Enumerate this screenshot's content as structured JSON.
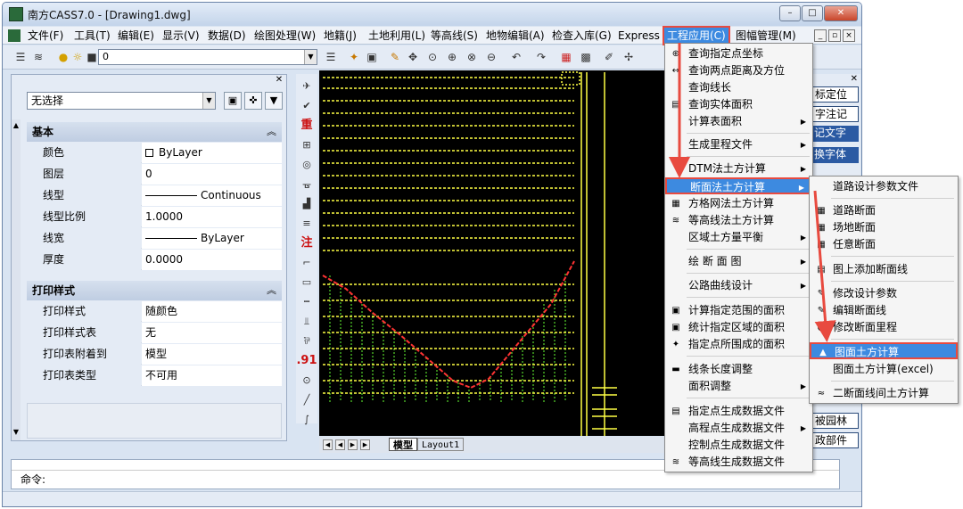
{
  "window": {
    "title": "南方CASS7.0 - [Drawing1.dwg]",
    "controls": {
      "minimize": "–",
      "maximize": "□",
      "close": "✕"
    }
  },
  "menubar": {
    "items": [
      "文件(F)",
      "工具(T)",
      "编辑(E)",
      "显示(V)",
      "数据(D)",
      "绘图处理(W)",
      "地籍(J)",
      "土地利用(L)",
      "等高线(S)",
      "地物编辑(A)",
      "检查入库(G)",
      "Express",
      "工程应用(C)",
      "图幅管理(M)"
    ],
    "active": "工程应用(C)",
    "mdi_controls": [
      "_",
      "▫",
      "×"
    ]
  },
  "toolbar": {
    "layer_value": "0"
  },
  "properties": {
    "selection": "无选择",
    "sections": [
      {
        "title": "基本",
        "rows": [
          {
            "name": "颜色",
            "value": "ByLayer",
            "kind": "color"
          },
          {
            "name": "图层",
            "value": "0",
            "kind": "text"
          },
          {
            "name": "线型",
            "value": "Continuous",
            "kind": "line"
          },
          {
            "name": "线型比例",
            "value": "1.0000",
            "kind": "text"
          },
          {
            "name": "线宽",
            "value": "ByLayer",
            "kind": "line"
          },
          {
            "name": "厚度",
            "value": "0.0000",
            "kind": "text"
          }
        ]
      },
      {
        "title": "打印样式",
        "rows": [
          {
            "name": "打印样式",
            "value": "随颜色",
            "kind": "text"
          },
          {
            "name": "打印样式表",
            "value": "无",
            "kind": "text"
          },
          {
            "name": "打印表附着到",
            "value": "模型",
            "kind": "text"
          },
          {
            "name": "打印表类型",
            "value": "不可用",
            "kind": "text"
          }
        ]
      }
    ]
  },
  "vtoolbar": {
    "labels": {
      "zhong": "重",
      "zhu": "注",
      "num": ".91"
    }
  },
  "layout_tabs": [
    "模型",
    "Layout1"
  ],
  "right_panel": [
    "标定位",
    "字注记",
    "记文字",
    "换字体",
    "",
    "",
    "被园林",
    "政部件"
  ],
  "command": {
    "prompt": "命令:"
  },
  "dropdown": [
    {
      "label": "查询指定点坐标",
      "icon": "⊕",
      "submenu": false
    },
    {
      "label": "查询两点距离及方位",
      "icon": "↔",
      "submenu": false
    },
    {
      "label": "查询线长",
      "icon": "",
      "submenu": false
    },
    {
      "label": "查询实体面积",
      "icon": "▤",
      "submenu": false
    },
    {
      "label": "计算表面积",
      "icon": "",
      "submenu": true
    },
    {
      "sep": true
    },
    {
      "label": "生成里程文件",
      "icon": "",
      "submenu": true
    },
    {
      "sep": true
    },
    {
      "label": "DTM法土方计算",
      "icon": "",
      "submenu": true
    },
    {
      "label": "断面法土方计算",
      "icon": "",
      "submenu": true,
      "highlighted": true
    },
    {
      "label": "方格网法土方计算",
      "icon": "▦",
      "submenu": false
    },
    {
      "label": "等高线法土方计算",
      "icon": "≋",
      "submenu": false
    },
    {
      "label": "区域土方量平衡",
      "icon": "",
      "submenu": true
    },
    {
      "sep": true
    },
    {
      "label": "绘 断 面 图",
      "icon": "",
      "submenu": true
    },
    {
      "sep": true
    },
    {
      "label": "公路曲线设计",
      "icon": "",
      "submenu": true
    },
    {
      "sep": true
    },
    {
      "label": "计算指定范围的面积",
      "icon": "▣",
      "submenu": false
    },
    {
      "label": "统计指定区域的面积",
      "icon": "▣",
      "submenu": false
    },
    {
      "label": "指定点所围成的面积",
      "icon": "✦",
      "submenu": false
    },
    {
      "sep": true
    },
    {
      "label": "线条长度调整",
      "icon": "▬",
      "submenu": false
    },
    {
      "label": "面积调整",
      "icon": "",
      "submenu": true
    },
    {
      "sep": true
    },
    {
      "label": "指定点生成数据文件",
      "icon": "▤",
      "submenu": false
    },
    {
      "label": "高程点生成数据文件",
      "icon": "",
      "submenu": true
    },
    {
      "label": "控制点生成数据文件",
      "icon": "",
      "submenu": false
    },
    {
      "label": "等高线生成数据文件",
      "icon": "≋",
      "submenu": false
    }
  ],
  "submenu": [
    {
      "label": "道路设计参数文件",
      "icon": ""
    },
    {
      "sep": true
    },
    {
      "label": "道路断面",
      "icon": "▦"
    },
    {
      "label": "场地断面",
      "icon": "▦"
    },
    {
      "label": "任意断面",
      "icon": "▦"
    },
    {
      "sep": true
    },
    {
      "label": "图上添加断面线",
      "icon": "▤"
    },
    {
      "sep": true
    },
    {
      "label": "修改设计参数",
      "icon": "✎"
    },
    {
      "label": "编辑断面线",
      "icon": "✎"
    },
    {
      "label": "修改断面里程",
      "icon": "●"
    },
    {
      "sep": true
    },
    {
      "label": "图面土方计算",
      "icon": "▲",
      "highlighted": true
    },
    {
      "label": "图面土方计算(excel)",
      "icon": ""
    },
    {
      "sep": true
    },
    {
      "label": "二断面线间土方计算",
      "icon": "≈"
    }
  ],
  "colors": {
    "highlight_bg": "#3d8ae0",
    "highlight_border": "#e84a3f",
    "annotation_arrow": "#e84a3f",
    "canvas_bg": "#000000",
    "section_line": "#ffff44",
    "grid": "#66ff33",
    "terrain": "#ff3333"
  }
}
